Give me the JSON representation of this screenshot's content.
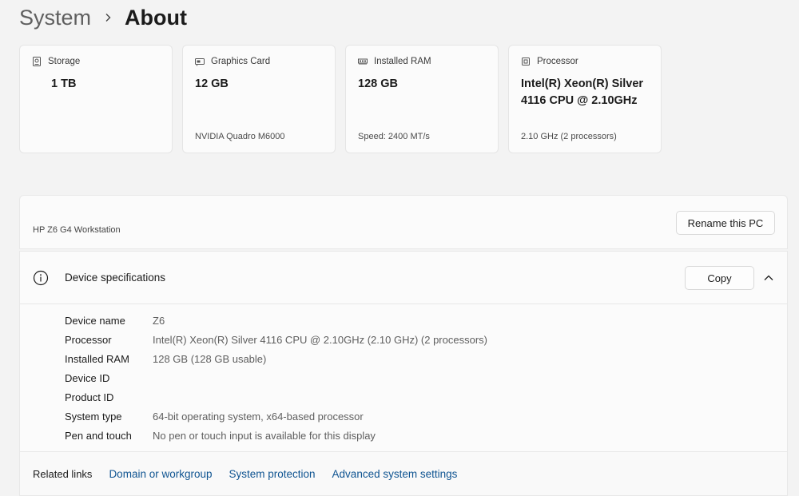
{
  "breadcrumb": {
    "parent": "System",
    "current": "About"
  },
  "cards": [
    {
      "label": "Storage",
      "value": "1 TB",
      "sub": "",
      "icon": "storage-icon"
    },
    {
      "label": "Graphics Card",
      "value": "12 GB",
      "sub": "NVIDIA Quadro M6000",
      "icon": "graphics-card-icon"
    },
    {
      "label": "Installed RAM",
      "value": "128 GB",
      "sub": "Speed: 2400 MT/s",
      "icon": "ram-icon"
    },
    {
      "label": "Processor",
      "value": "Intel(R) Xeon(R) Silver 4116 CPU @ 2.10GHz",
      "sub": "2.10 GHz (2 processors)",
      "icon": "processor-icon"
    }
  ],
  "pc": {
    "model": "HP Z6 G4 Workstation",
    "rename_label": "Rename this PC"
  },
  "specs": {
    "title": "Device specifications",
    "copy_label": "Copy",
    "rows": [
      {
        "label": "Device name",
        "value": "Z6"
      },
      {
        "label": "Processor",
        "value": "Intel(R) Xeon(R) Silver 4116 CPU @ 2.10GHz (2.10 GHz) (2 processors)"
      },
      {
        "label": "Installed RAM",
        "value": "128 GB (128 GB usable)"
      },
      {
        "label": "Device ID",
        "value": ""
      },
      {
        "label": "Product ID",
        "value": ""
      },
      {
        "label": "System type",
        "value": "64-bit operating system, x64-based processor"
      },
      {
        "label": "Pen and touch",
        "value": "No pen or touch input is available for this display"
      }
    ]
  },
  "related_links": {
    "label": "Related links",
    "links": [
      "Domain or workgroup",
      "System protection",
      "Advanced system settings"
    ]
  },
  "colors": {
    "link": "#0f5491",
    "background": "#f3f3f3",
    "card": "#fbfbfb"
  }
}
